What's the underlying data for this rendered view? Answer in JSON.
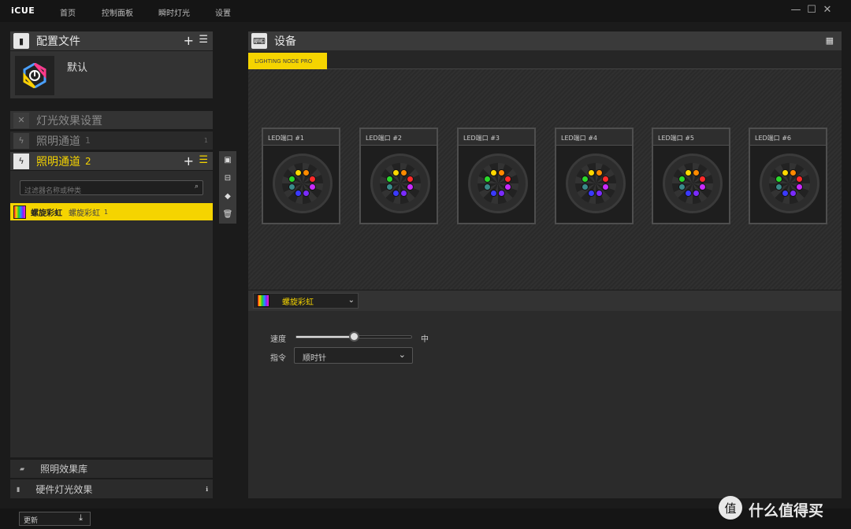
{
  "app": {
    "logo": "iCUE",
    "nav": [
      "首页",
      "控制面板",
      "瞬时灯光",
      "设置"
    ]
  },
  "window": {
    "minimize": "—",
    "maximize": "☐",
    "close": "✕"
  },
  "profiles": {
    "title": "配置文件",
    "add": "+",
    "menu": "☰",
    "items": [
      {
        "name": "默认"
      }
    ]
  },
  "lighting": {
    "settings_title": "灯光效果设置",
    "channel1": {
      "label": "照明通道",
      "num": "1"
    },
    "channel2": {
      "label": "照明通道",
      "num": "2",
      "add": "+",
      "menu": "☰"
    },
    "filter_placeholder": "过滤器名称或种类",
    "effects": [
      {
        "name": "螺旋彩虹",
        "sub": "螺旋彩虹",
        "num": "1"
      }
    ],
    "library": "照明效果库",
    "hardware": "硬件灯光效果"
  },
  "devices": {
    "title": "设备",
    "tab": "LIGHTING NODE PRO",
    "ports": [
      "LED端口 #1",
      "LED端口 #2",
      "LED端口 #3",
      "LED端口 #4",
      "LED端口 #5",
      "LED端口 #6"
    ]
  },
  "effect_settings": {
    "effect": "螺旋彩虹",
    "speed_label": "速度",
    "speed_value": "中",
    "speed_level": 0.5,
    "direction_label": "指令",
    "direction_value": "顺时针"
  },
  "footer": {
    "update": "更新",
    "brand": "什么值得买"
  },
  "colors": {
    "accent": "#f5d400",
    "led": [
      "#ffd800",
      "#ff8a00",
      "#ff2b2b",
      "#c82bff",
      "#7a2bff",
      "#3a3aff",
      "#3a8a8a",
      "#2bd82b"
    ]
  }
}
